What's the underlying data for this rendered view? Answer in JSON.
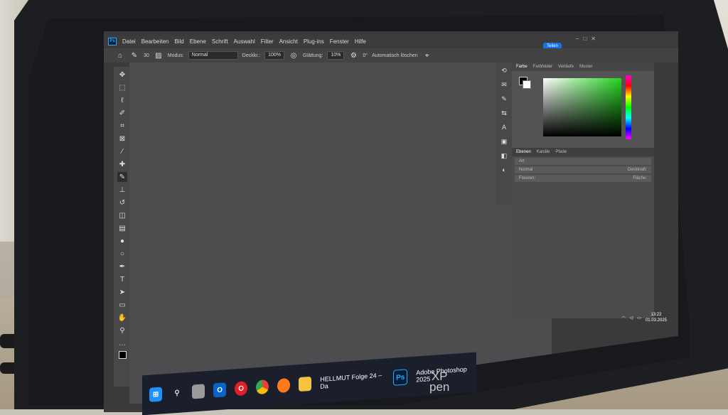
{
  "menu": [
    "Datei",
    "Bearbeiten",
    "Bild",
    "Ebene",
    "Schrift",
    "Auswahl",
    "Filter",
    "Ansicht",
    "Plug-ins",
    "Fenster",
    "Hilfe"
  ],
  "options": {
    "brush_size": "30",
    "mode_label": "Modus:",
    "mode_value": "Normal",
    "opacity_label": "Deckkr.:",
    "opacity_value": "100%",
    "smoothing_label": "Glättung:",
    "smoothing_value": "10%",
    "angle": "0°",
    "auto_erase": "Automatisch löschen",
    "share": "Teilen"
  },
  "color_panel": {
    "tabs": [
      "Farbe",
      "Farbfelder",
      "Verläufe",
      "Muster"
    ]
  },
  "layers_panel": {
    "tabs": [
      "Ebenen",
      "Kanäle",
      "Pfade"
    ],
    "filter": "Art",
    "blend": "Normal",
    "opacity_label": "Deckkraft:",
    "lock_label": "Fixieren:",
    "fill_label": "Fläche:"
  },
  "taskbar": {
    "items": [
      {
        "icon": "windows-icon",
        "color": "#1e90ff"
      },
      {
        "icon": "search-icon",
        "color": "#d9d9d9"
      },
      {
        "icon": "task-view-icon",
        "color": "#bbbbbb"
      },
      {
        "icon": "outlook-icon",
        "color": "#0a64c8"
      },
      {
        "icon": "opera-icon",
        "color": "#e0202a"
      },
      {
        "icon": "chrome-icon",
        "color": "#34a853"
      },
      {
        "icon": "firefox-icon",
        "color": "#ff7a1a"
      },
      {
        "icon": "folder-icon",
        "color": "#f5c242"
      }
    ],
    "folder_label": "HELLMUT Folge 24 – Da",
    "ps_label": "Adobe Photoshop 2025",
    "time": "13:22",
    "date": "01.03.2025"
  },
  "brand": {
    "line1": "XP",
    "line2": "pen"
  }
}
